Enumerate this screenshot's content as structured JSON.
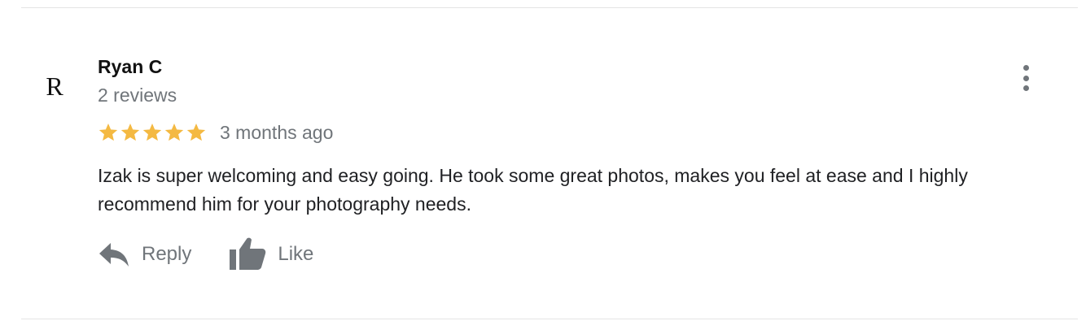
{
  "review": {
    "avatar_letter": "R",
    "reviewer_name": "Ryan C",
    "review_count": "2 reviews",
    "rating": 5,
    "rating_max": 5,
    "date": "3 months ago",
    "text": "Izak is super welcoming and easy going. He took some great photos, makes you feel at ease and I highly recommend him for your photography needs."
  },
  "actions": {
    "reply_label": "Reply",
    "like_label": "Like",
    "reply_icon": "reply-arrow-icon",
    "like_icon": "thumbs-up-icon",
    "more_icon": "more-vertical-icon"
  },
  "colors": {
    "star": "#f4b942",
    "secondary_text": "#70757a",
    "primary_text": "#202124"
  }
}
